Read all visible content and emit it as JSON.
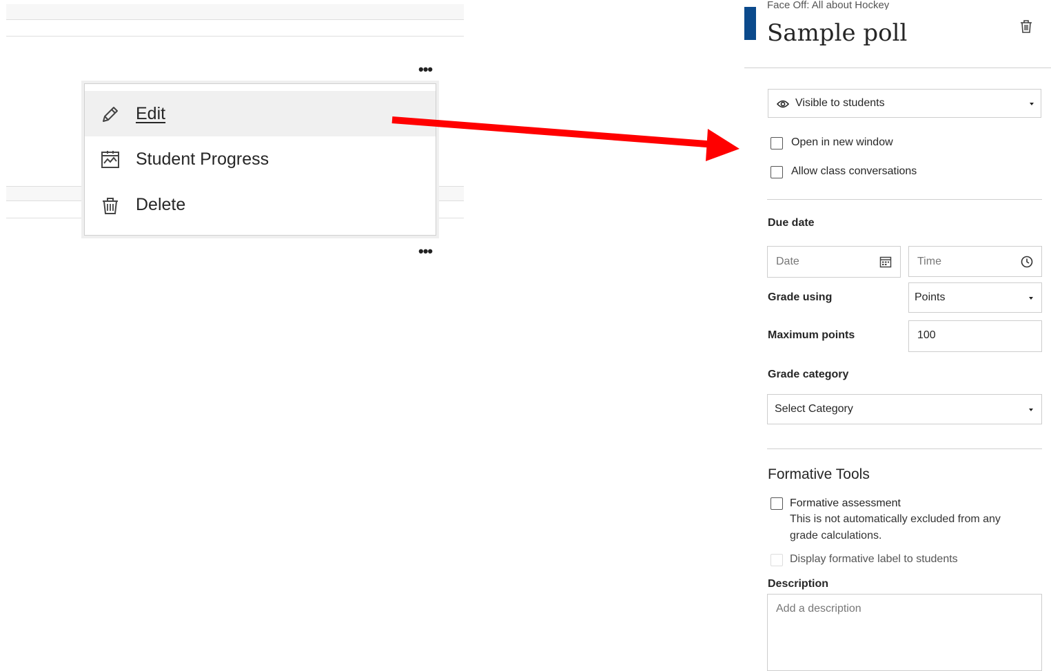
{
  "context_menu": {
    "more_icon": "ellipsis-icon",
    "items": [
      {
        "label": "Edit",
        "icon": "pencil-icon"
      },
      {
        "label": "Student Progress",
        "icon": "progress-chart-icon"
      },
      {
        "label": "Delete",
        "icon": "trash-icon"
      }
    ]
  },
  "annotation": {
    "arrow_color": "#ff0000"
  },
  "panel": {
    "breadcrumb": "Face Off: All about Hockey",
    "title": "Sample poll",
    "accent_color": "#0b4a8c",
    "visibility": {
      "icon": "eye-icon",
      "value": "Visible to students"
    },
    "checkboxes": {
      "open_new_window": "Open in new window",
      "allow_conversations": "Allow class conversations"
    },
    "due_date": {
      "label": "Due date",
      "date_placeholder": "Date",
      "time_placeholder": "Time"
    },
    "grade_using": {
      "label": "Grade using",
      "value": "Points"
    },
    "max_points": {
      "label": "Maximum points",
      "value": "100"
    },
    "grade_category": {
      "label": "Grade category",
      "value": "Select Category"
    },
    "formative": {
      "heading": "Formative Tools",
      "assessment_label": "Formative assessment",
      "assessment_note": "This is not automatically excluded from any grade calculations.",
      "display_label": "Display formative label to students"
    },
    "description": {
      "label": "Description",
      "placeholder": "Add a description"
    }
  }
}
